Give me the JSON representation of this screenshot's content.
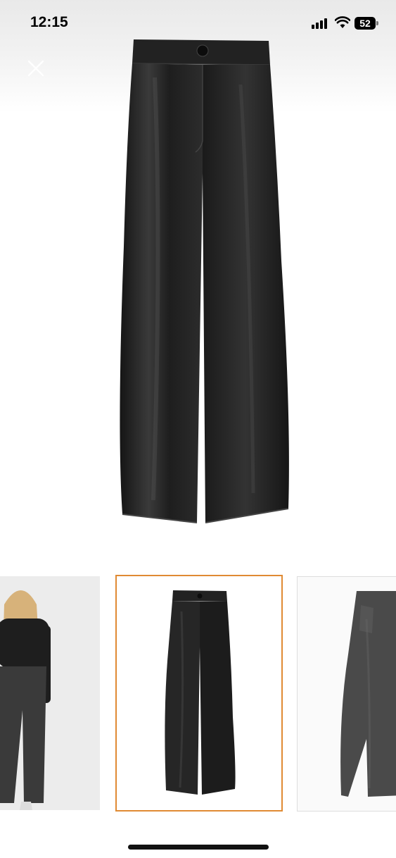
{
  "status_bar": {
    "time": "12:15",
    "battery_level": "52"
  },
  "colors": {
    "selected_thumbnail_border": "#e08a33",
    "leather": "#1f1f1f"
  },
  "icons": {
    "close": "close-icon"
  },
  "gallery": {
    "thumbnails": [
      {
        "selected": false
      },
      {
        "selected": true
      },
      {
        "selected": false
      }
    ]
  }
}
